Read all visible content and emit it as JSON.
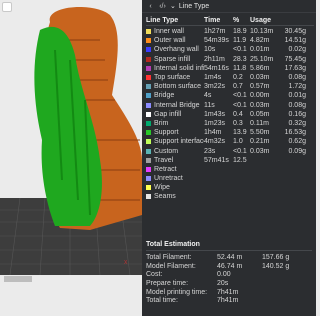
{
  "viewport": {
    "label": "3D preview of a bust printed on a build plate",
    "colors": {
      "outer_wall": "#d2641e",
      "support": "#1ea01e",
      "plate": "#3a3a3a"
    }
  },
  "panel": {
    "top_icons": [
      "chevron-left-icon",
      "code-icon"
    ],
    "view_type": "Line Type",
    "columns": {
      "type": "Line Type",
      "time": "Time",
      "pct": "%",
      "usage": "Usage"
    },
    "rows": [
      {
        "name": "Inner wall",
        "color": "#f0dc5a",
        "time": "1h27m",
        "pct": "18.9",
        "length": "10.13m",
        "weight": "30.45g"
      },
      {
        "name": "Outer wall",
        "color": "#ff8c1a",
        "time": "54m39s",
        "pct": "11.9",
        "length": "4.82m",
        "weight": "14.51g"
      },
      {
        "name": "Overhang wall",
        "color": "#3c3cff",
        "time": "10s",
        "pct": "<0.1",
        "length": "0.01m",
        "weight": "0.02g"
      },
      {
        "name": "Sparse infill",
        "color": "#b4281e",
        "time": "2h11m",
        "pct": "28.3",
        "length": "25.10m",
        "weight": "75.45g"
      },
      {
        "name": "Internal solid infill",
        "color": "#b43cb4",
        "time": "54m16s",
        "pct": "11.8",
        "length": "5.86m",
        "weight": "17.63g"
      },
      {
        "name": "Top surface",
        "color": "#ff3232",
        "time": "1m4s",
        "pct": "0.2",
        "length": "0.03m",
        "weight": "0.08g"
      },
      {
        "name": "Bottom surface",
        "color": "#64a0b4",
        "time": "3m22s",
        "pct": "0.7",
        "length": "0.57m",
        "weight": "1.72g"
      },
      {
        "name": "Bridge",
        "color": "#50a0c8",
        "time": "4s",
        "pct": "<0.1",
        "length": "0.00m",
        "weight": "0.01g"
      },
      {
        "name": "Internal Bridge",
        "color": "#8c8cff",
        "time": "11s",
        "pct": "<0.1",
        "length": "0.03m",
        "weight": "0.08g"
      },
      {
        "name": "Gap infill",
        "color": "#ffffff",
        "time": "1m43s",
        "pct": "0.4",
        "length": "0.05m",
        "weight": "0.16g"
      },
      {
        "name": "Brim",
        "color": "#00aa6e",
        "time": "1m23s",
        "pct": "0.3",
        "length": "0.11m",
        "weight": "0.32g"
      },
      {
        "name": "Support",
        "color": "#28c828",
        "time": "1h4m",
        "pct": "13.9",
        "length": "5.50m",
        "weight": "16.53g"
      },
      {
        "name": "Support interface",
        "color": "#c0ff5a",
        "time": "4m32s",
        "pct": "1.0",
        "length": "0.21m",
        "weight": "0.62g"
      },
      {
        "name": "Custom",
        "color": "#5ab4b4",
        "time": "23s",
        "pct": "<0.1",
        "length": "0.03m",
        "weight": "0.09g"
      },
      {
        "name": "Travel",
        "color": "#a0a0a0",
        "time": "57m41s",
        "pct": "12.5",
        "length": "",
        "weight": ""
      },
      {
        "name": "Retract",
        "color": "#e63cff",
        "time": "",
        "pct": "",
        "length": "",
        "weight": ""
      },
      {
        "name": "Unretract",
        "color": "#8c8cff",
        "time": "",
        "pct": "",
        "length": "",
        "weight": ""
      },
      {
        "name": "Wipe",
        "color": "#ffff50",
        "time": "",
        "pct": "",
        "length": "",
        "weight": ""
      },
      {
        "name": "Seams",
        "color": "#e6e6e6",
        "time": "",
        "pct": "",
        "length": "",
        "weight": ""
      }
    ]
  },
  "estimation": {
    "title": "Total Estimation",
    "rows": [
      {
        "label": "Total Filament:",
        "v1": "52.44 m",
        "v2": "157.66 g"
      },
      {
        "label": "Model Filament:",
        "v1": "46.74 m",
        "v2": "140.52 g"
      },
      {
        "label": "Cost:",
        "v1": "0.00",
        "v2": ""
      },
      {
        "label": "Prepare time:",
        "v1": "20s",
        "v2": ""
      },
      {
        "label": "Model printing time:",
        "v1": "7h41m",
        "v2": ""
      },
      {
        "label": "Total time:",
        "v1": "7h41m",
        "v2": ""
      }
    ]
  }
}
